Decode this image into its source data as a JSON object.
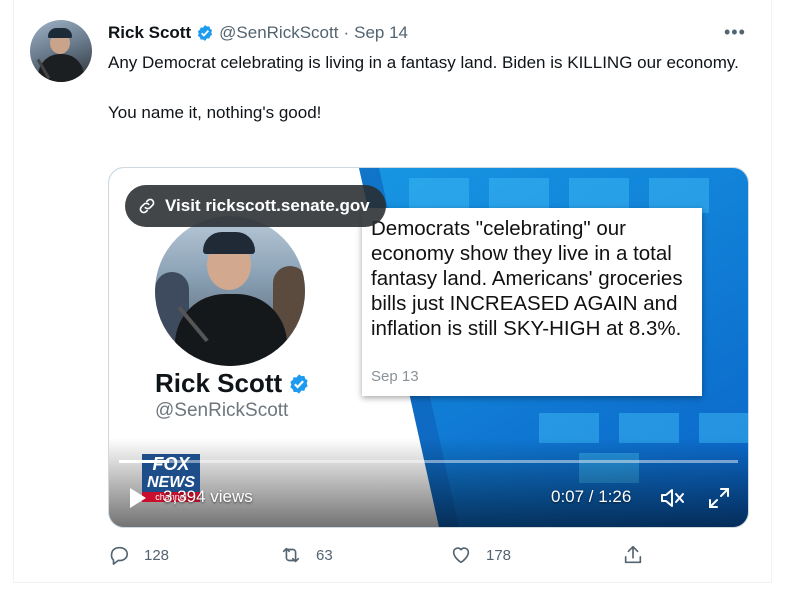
{
  "tweet": {
    "author_name": "Rick Scott",
    "handle": "@SenRickScott",
    "separator": "·",
    "date": "Sep 14",
    "more_label": "•••",
    "text": "Any Democrat celebrating is living in a fantasy land. Biden is KILLING our economy.\n\nYou name it, nothing's good!"
  },
  "media": {
    "visit_label": "Visit rickscott.senate.gov",
    "card_name": "Rick Scott",
    "card_handle": "@SenRickScott",
    "quote_text": "Democrats \"celebrating\" our economy show they live in a total fantasy land. Americans' groceries bills just INCREASED AGAIN and inflation is still SKY-HIGH at 8.3%.",
    "quote_date": "Sep 13",
    "fox_line1": "FOX",
    "fox_line2": "NEWS",
    "fox_line3": "channel",
    "views": "3,394 views",
    "time": "0:07 / 1:26",
    "progress_fraction": 0.08
  },
  "actions": {
    "reply_count": "128",
    "retweet_count": "63",
    "like_count": "178"
  },
  "colors": {
    "verified": "#1d9bf0",
    "muted_text": "#536471",
    "fox_blue": "#1d4e89",
    "fox_red": "#c8102e"
  },
  "icons": [
    "verified-badge-icon",
    "more-icon",
    "link-icon",
    "play-icon",
    "mute-icon",
    "fullscreen-icon",
    "reply-icon",
    "retweet-icon",
    "like-icon",
    "share-icon"
  ]
}
